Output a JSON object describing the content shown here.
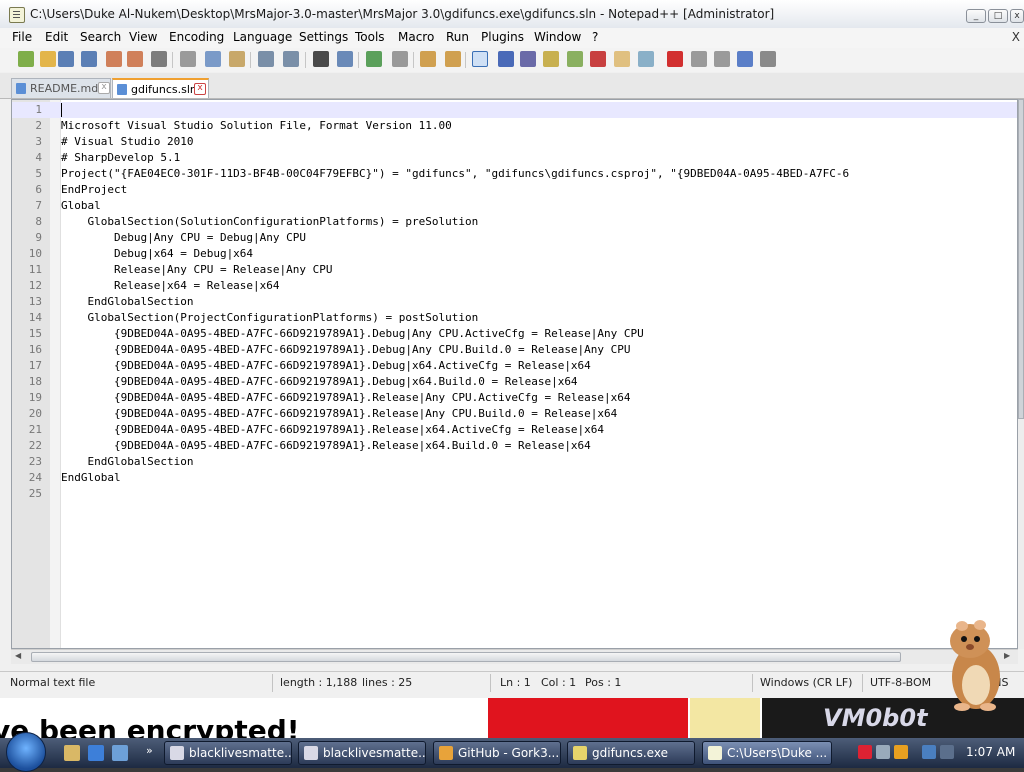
{
  "window": {
    "title": "C:\\Users\\Duke Al-Nukem\\Desktop\\MrsMajor-3.0-master\\MrsMajor 3.0\\gdifuncs.exe\\gdifuncs.sln - Notepad++ [Administrator]"
  },
  "menu": {
    "items": [
      "File",
      "Edit",
      "Search",
      "View",
      "Encoding",
      "Language",
      "Settings",
      "Tools",
      "Macro",
      "Run",
      "Plugins",
      "Window",
      "?"
    ],
    "close_glyph": "X"
  },
  "toolbar": {
    "buttons": [
      "new-file-icon",
      "open-file-icon",
      "save-icon",
      "save-all-icon",
      "close-icon",
      "close-all-icon",
      "print-icon",
      "cut-icon",
      "copy-icon",
      "paste-icon",
      "undo-icon",
      "redo-icon",
      "find-icon",
      "replace-icon",
      "zoom-in-icon",
      "zoom-out-icon",
      "sync-vertical-icon",
      "sync-horizontal-icon",
      "word-wrap-icon",
      "show-all-chars-icon",
      "indent-guide-icon",
      "user-language-icon",
      "doc-map-icon",
      "function-list-icon",
      "folder-workspace-icon",
      "monitoring-icon",
      "record-macro-icon",
      "stop-macro-icon",
      "play-macro-icon",
      "run-macro-multiple-icon",
      "save-macro-icon"
    ]
  },
  "tabs": [
    {
      "label": "README.md",
      "active": false
    },
    {
      "label": "gdifuncs.sln",
      "active": true
    }
  ],
  "editor": {
    "lines": [
      "",
      "Microsoft Visual Studio Solution File, Format Version 11.00",
      "# Visual Studio 2010",
      "# SharpDevelop 5.1",
      "Project(\"{FAE04EC0-301F-11D3-BF4B-00C04F79EFBC}\") = \"gdifuncs\", \"gdifuncs\\gdifuncs.csproj\", \"{9DBED04A-0A95-4BED-A7FC-6",
      "EndProject",
      "Global",
      "    GlobalSection(SolutionConfigurationPlatforms) = preSolution",
      "        Debug|Any CPU = Debug|Any CPU",
      "        Debug|x64 = Debug|x64",
      "        Release|Any CPU = Release|Any CPU",
      "        Release|x64 = Release|x64",
      "    EndGlobalSection",
      "    GlobalSection(ProjectConfigurationPlatforms) = postSolution",
      "        {9DBED04A-0A95-4BED-A7FC-66D9219789A1}.Debug|Any CPU.ActiveCfg = Release|Any CPU",
      "        {9DBED04A-0A95-4BED-A7FC-66D9219789A1}.Debug|Any CPU.Build.0 = Release|Any CPU",
      "        {9DBED04A-0A95-4BED-A7FC-66D9219789A1}.Debug|x64.ActiveCfg = Release|x64",
      "        {9DBED04A-0A95-4BED-A7FC-66D9219789A1}.Debug|x64.Build.0 = Release|x64",
      "        {9DBED04A-0A95-4BED-A7FC-66D9219789A1}.Release|Any CPU.ActiveCfg = Release|x64",
      "        {9DBED04A-0A95-4BED-A7FC-66D9219789A1}.Release|Any CPU.Build.0 = Release|x64",
      "        {9DBED04A-0A95-4BED-A7FC-66D9219789A1}.Release|x64.ActiveCfg = Release|x64",
      "        {9DBED04A-0A95-4BED-A7FC-66D9219789A1}.Release|x64.Build.0 = Release|x64",
      "    EndGlobalSection",
      "EndGlobal",
      ""
    ],
    "current_line": 1
  },
  "status": {
    "file_type": "Normal text file",
    "length": "length : 1,188",
    "lines": "lines : 25",
    "ln": "Ln : 1",
    "col": "Col : 1",
    "pos": "Pos : 1",
    "eol": "Windows (CR LF)",
    "encoding": "UTF-8-BOM",
    "ins": "INS"
  },
  "desktop": {
    "encrypted_text": "ve been encrypted!",
    "logo_text": "VM0b0t"
  },
  "taskbar": {
    "tasks": [
      {
        "label": "blacklivesmatte...",
        "icon_color": "#d9d9e6",
        "active": false
      },
      {
        "label": "blacklivesmatte...",
        "icon_color": "#d9d9e6",
        "active": false
      },
      {
        "label": "GitHub - Gork3...",
        "icon_color": "#e8a33a",
        "active": false
      },
      {
        "label": "gdifuncs.exe",
        "icon_color": "#e6d36b",
        "active": false
      },
      {
        "label": "C:\\Users\\Duke ...",
        "icon_color": "#f3f3d8",
        "active": true
      }
    ],
    "clock": "1:07 AM"
  },
  "colors": {
    "current_line": "#e8e8ff",
    "red_panel": "#e0141e",
    "taskbar": "#1d2a42"
  }
}
